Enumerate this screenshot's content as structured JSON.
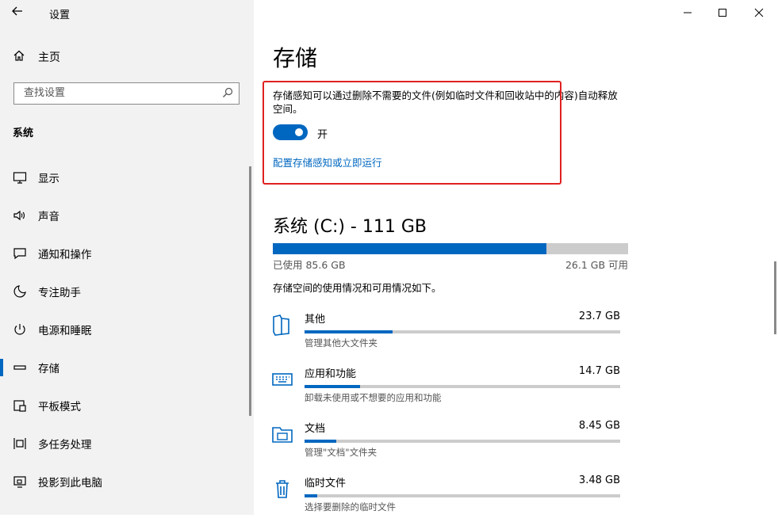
{
  "app": {
    "title": "设置"
  },
  "sidebar": {
    "home_label": "主页",
    "search_placeholder": "查找设置",
    "section_label": "系统",
    "items": [
      {
        "label": "显示",
        "icon": "monitor-icon"
      },
      {
        "label": "声音",
        "icon": "speaker-icon"
      },
      {
        "label": "通知和操作",
        "icon": "notification-icon"
      },
      {
        "label": "专注助手",
        "icon": "moon-icon"
      },
      {
        "label": "电源和睡眠",
        "icon": "power-icon"
      },
      {
        "label": "存储",
        "icon": "storage-icon",
        "selected": true
      },
      {
        "label": "平板模式",
        "icon": "tablet-icon"
      },
      {
        "label": "多任务处理",
        "icon": "multitask-icon"
      },
      {
        "label": "投影到此电脑",
        "icon": "project-icon"
      }
    ]
  },
  "main": {
    "title": "存储",
    "sense_desc": "存储感知可以通过删除不需要的文件(例如临时文件和回收站中的内容)自动释放空间。",
    "toggle_label": "开",
    "toggle_on": true,
    "config_link": "配置存储感知或立即运行",
    "drive": {
      "title": "系统 (C:) - 111 GB",
      "used_label": "已使用 85.6 GB",
      "free_label": "26.1 GB 可用",
      "used_fraction": 0.77
    },
    "usage_desc": "存储空间的使用情况和可用情况如下。",
    "categories": [
      {
        "name": "其他",
        "size": "23.7 GB",
        "sub": "管理其他大文件夹",
        "fraction": 0.28,
        "icon": "file-icon"
      },
      {
        "name": "应用和功能",
        "size": "14.7 GB",
        "sub": "卸载未使用或不想要的应用和功能",
        "fraction": 0.175,
        "icon": "keyboard-icon"
      },
      {
        "name": "文档",
        "size": "8.45 GB",
        "sub": "管理\"文档\"文件夹",
        "fraction": 0.1,
        "icon": "folder-icon"
      },
      {
        "name": "临时文件",
        "size": "3.48 GB",
        "sub": "选择要删除的临时文件",
        "fraction": 0.04,
        "icon": "trash-icon"
      }
    ]
  },
  "colors": {
    "accent": "#0067c0",
    "highlight_box": "#e02020",
    "sidebar_bg": "#f2f2f2"
  }
}
